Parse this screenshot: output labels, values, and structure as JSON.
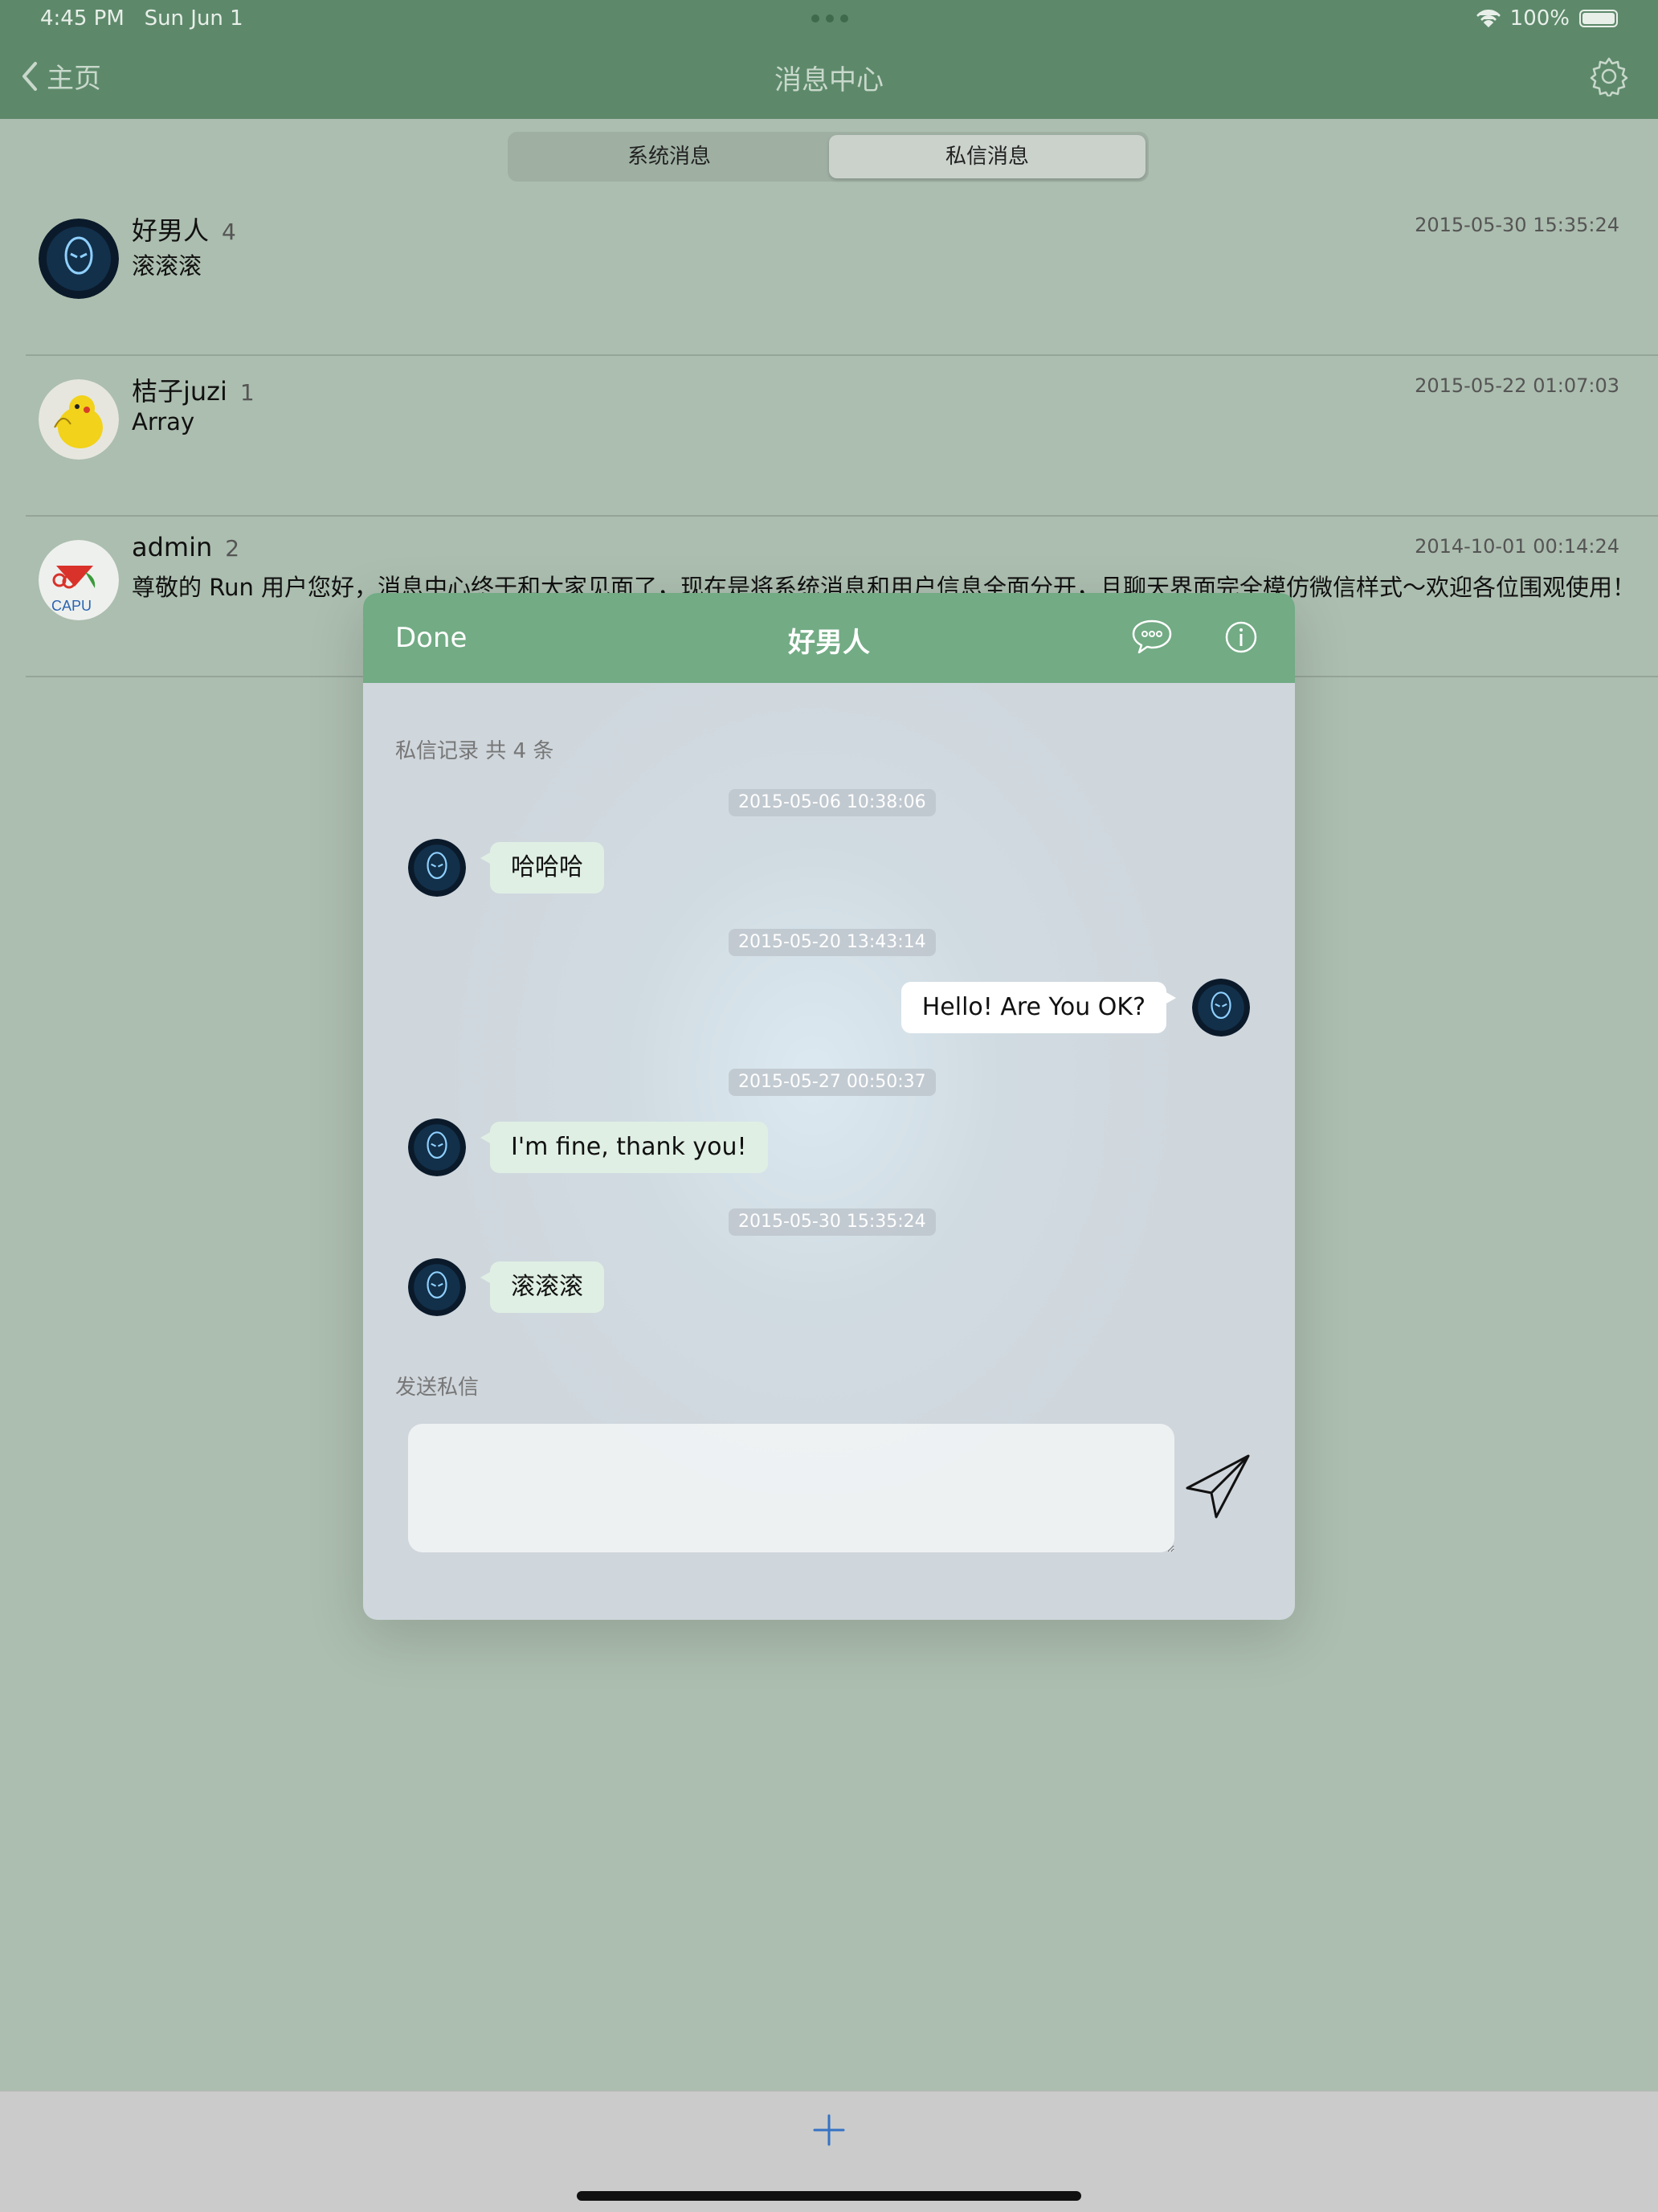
{
  "status_bar": {
    "time": "4:45 PM",
    "date": "Sun Jun 1",
    "battery": "100%"
  },
  "nav": {
    "back_label": "主页",
    "title": "消息中心"
  },
  "segments": {
    "system": "系统消息",
    "private": "私信消息",
    "selected": "私信消息"
  },
  "conversations": [
    {
      "name": "好男人",
      "count": "4",
      "preview": "滚滚滚",
      "date": "2015-05-30 15:35:24"
    },
    {
      "name": "桔子juzi",
      "count": "1",
      "preview": "Array",
      "date": "2015-05-22 01:07:03"
    },
    {
      "name": "admin",
      "count": "2",
      "preview": "尊敬的 Run 用户您好，消息中心终于和大家见面了，现在是将系统消息和用户信息全面分开，且聊天界面完全模仿微信样式～欢迎各位围观使用！",
      "date": "2014-10-01 00:14:24"
    }
  ],
  "modal": {
    "done_label": "Done",
    "title": "好男人",
    "records_label": "私信记录 共 4 条",
    "messages": [
      {
        "time": "2015-05-06 10:38:06",
        "text": "哈哈哈",
        "direction": "in"
      },
      {
        "time": "2015-05-20 13:43:14",
        "text": "Hello! Are You OK?",
        "direction": "out"
      },
      {
        "time": "2015-05-27 00:50:37",
        "text": "I'm fine, thank you!",
        "direction": "in"
      },
      {
        "time": "2015-05-30 15:35:24",
        "text": "滚滚滚",
        "direction": "in"
      }
    ],
    "send_label": "发送私信",
    "input_value": ""
  },
  "toolbar": {
    "add_icon": "plus-icon"
  },
  "colors": {
    "nav_bg": "#5d896a",
    "modal_header": "#72ab84",
    "page_bg": "#acbeaf",
    "accent_blue": "#3573c5"
  }
}
